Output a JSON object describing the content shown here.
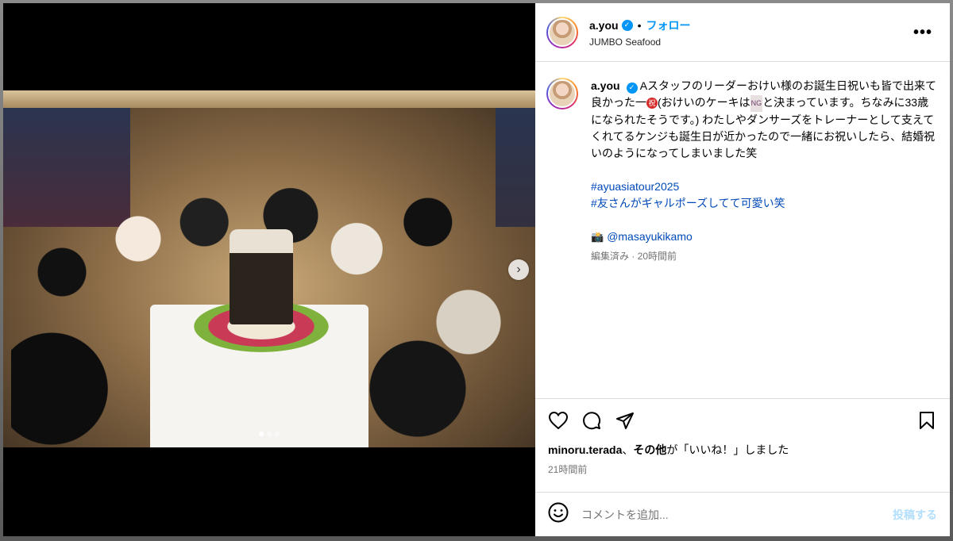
{
  "post": {
    "username": "a.you",
    "follow_label": "フォロー",
    "location": "JUMBO Seafood",
    "more_label": "•••"
  },
  "caption": {
    "username": "a.you",
    "text_1": "Aスタッフのリーダーおけい様のお誕生日祝いも皆で出来て良かった一",
    "emoji_tax": "祝",
    "text_2": "(おけいのケーキは",
    "emoji_ng": "NG",
    "text_3": "と決まっています。ちなみに33歳になられたそうです。) わたしやダンサーズをトレーナーとして支えてくれてるケンジも誕生日が近かったので一緒にお祝いしたら、結婚祝いのようになってしまいました笑",
    "hashtags": [
      "#ayuasiatour2025",
      "#友さんがギャルポーズしてて可愛い笑"
    ],
    "camera_emoji": "📸",
    "mention": "@masayukikamo",
    "edited_meta": "編集済み · 20時間前"
  },
  "engagement": {
    "liker": "minoru.terada",
    "likes_connector": "、",
    "others": "その他",
    "likes_suffix": "が「いいね！」しました",
    "time": "21時間前"
  },
  "comment": {
    "placeholder": "コメントを追加...",
    "post_label": "投稿する"
  },
  "carousel": {
    "next_glyph": "›",
    "total": 3,
    "active_index": 1
  },
  "colors": {
    "link_blue": "#0095f6",
    "hashtag_blue": "#0049b7",
    "post_disabled": "#b2dffc"
  }
}
